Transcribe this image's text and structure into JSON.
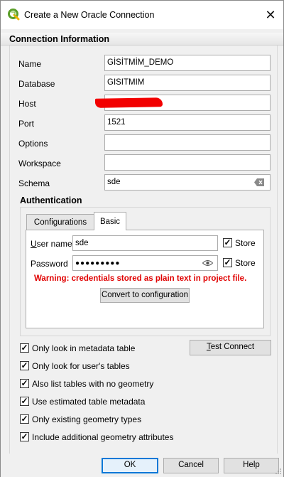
{
  "window": {
    "title": "Create a New Oracle Connection",
    "close_symbol": "✕",
    "app_icon": "qgis-icon"
  },
  "connection": {
    "section_title": "Connection Information",
    "fields": {
      "name": {
        "label": "Name",
        "value": "GİSİTMİM_DEMO"
      },
      "database": {
        "label": "Database",
        "value": "GISITMIM"
      },
      "host": {
        "label": "Host",
        "value": ""
      },
      "port": {
        "label": "Port",
        "value": "1521"
      },
      "options": {
        "label": "Options",
        "value": ""
      },
      "workspace": {
        "label": "Workspace",
        "value": ""
      },
      "schema": {
        "label": "Schema",
        "value": "sde"
      }
    }
  },
  "auth": {
    "title": "Authentication",
    "tabs": [
      {
        "label": "Configurations",
        "active": false
      },
      {
        "label": "Basic",
        "active": true
      }
    ],
    "username": {
      "label_prefix": "U",
      "label_rest": "ser name",
      "value": "sde",
      "store_label": "Store",
      "store_checked": true
    },
    "password": {
      "label": "Password",
      "value": "●●●●●●●●●",
      "store_label": "Store",
      "store_checked": true
    },
    "warning": "Warning: credentials stored as plain text in project file.",
    "convert_button": "Convert to configuration"
  },
  "options": [
    {
      "label": "Only look in metadata table",
      "checked": true
    },
    {
      "label": "Only look for user's tables",
      "checked": true
    },
    {
      "label": "Also list tables with no geometry",
      "checked": true
    },
    {
      "label": "Use estimated table metadata",
      "checked": true
    },
    {
      "label": "Only existing geometry types",
      "checked": true
    },
    {
      "label": "Include additional geometry attributes",
      "checked": true
    }
  ],
  "test_connect": {
    "prefix": "T",
    "rest": "est Connect"
  },
  "dialog_buttons": {
    "ok": "OK",
    "cancel": "Cancel",
    "help": "Help"
  },
  "colors": {
    "warning": "#e00000",
    "redaction": "#f20000",
    "focus": "#0078d7"
  }
}
